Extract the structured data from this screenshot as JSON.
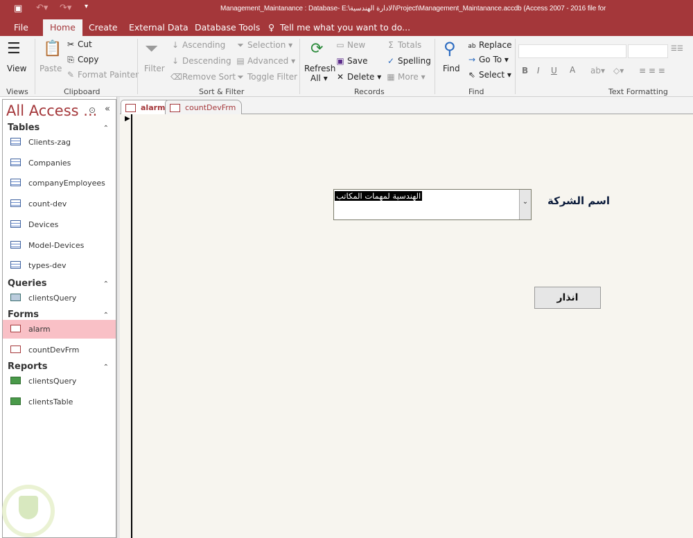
{
  "window": {
    "title": "Management_Maintanance : Database- E:\\الادارة الهندسية\\Project\\Management_Maintanance.accdb (Access 2007 - 2016 file for"
  },
  "ribbon_tabs": [
    "File",
    "Home",
    "Create",
    "External Data",
    "Database Tools"
  ],
  "tell_me": "Tell me what you want to do...",
  "groups": {
    "views": {
      "label": "Views",
      "view": "View"
    },
    "clipboard": {
      "label": "Clipboard",
      "paste": "Paste",
      "cut": "Cut",
      "copy": "Copy",
      "format_painter": "Format Painter"
    },
    "sort_filter": {
      "label": "Sort & Filter",
      "filter": "Filter",
      "ascending": "Ascending",
      "descending": "Descending",
      "remove_sort": "Remove Sort",
      "selection": "Selection",
      "advanced": "Advanced",
      "toggle_filter": "Toggle Filter"
    },
    "records": {
      "label": "Records",
      "refresh": "Refresh",
      "refresh2": "All",
      "new": "New",
      "save": "Save",
      "delete": "Delete",
      "totals": "Totals",
      "spelling": "Spelling",
      "more": "More"
    },
    "find": {
      "label": "Find",
      "find": "Find",
      "replace": "Replace",
      "goto": "Go To",
      "select": "Select"
    },
    "text_formatting": {
      "label": "Text Formatting",
      "bold": "B",
      "italic": "I",
      "underline": "U",
      "font_color": "A"
    }
  },
  "nav": {
    "title": "All Access ...",
    "sections": [
      {
        "name": "Tables",
        "items": [
          "Clients-zag",
          "Companies",
          "companyEmployees",
          "count-dev",
          "Devices",
          "Model-Devices",
          "types-dev"
        ]
      },
      {
        "name": "Queries",
        "items": [
          "clientsQuery"
        ]
      },
      {
        "name": "Forms",
        "items": [
          "alarm",
          "countDevFrm"
        ]
      },
      {
        "name": "Reports",
        "items": [
          "clientsQuery",
          "clientsTable"
        ]
      }
    ],
    "selected": "alarm"
  },
  "doc_tabs": [
    "alarm",
    "countDevFrm"
  ],
  "form": {
    "company_label": "اسم الشركة",
    "company_value": "الهندسية لمهمات المكاتب",
    "alarm_button": "انذار"
  },
  "colors": {
    "accent": "#a4373a",
    "form_bg": "#f7f5ef",
    "selected": "#f9c0c6"
  }
}
